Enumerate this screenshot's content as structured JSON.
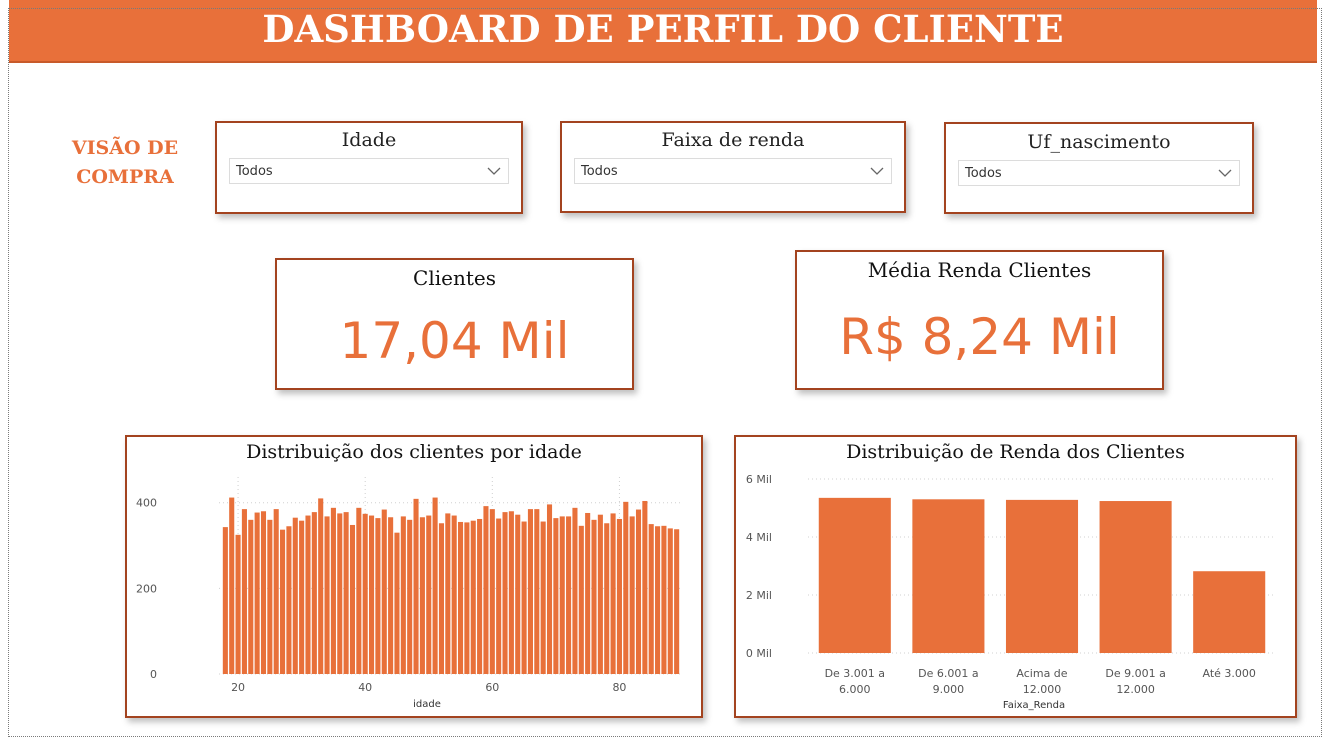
{
  "header": {
    "title": "DASHBOARD DE PERFIL DO CLIENTE"
  },
  "side_label": "VISÃO DE COMPRA",
  "slicers": [
    {
      "title": "Idade",
      "value": "Todos"
    },
    {
      "title": "Faixa de renda",
      "value": "Todos"
    },
    {
      "title": "Uf_nascimento",
      "value": "Todos"
    }
  ],
  "kpis": {
    "clientes": {
      "title": "Clientes",
      "value": "17,04 Mil"
    },
    "media_renda": {
      "title": "Média Renda Clientes",
      "value": "R$ 8,24 Mil"
    }
  },
  "colors": {
    "accent": "#e8703a",
    "border": "#a3431f",
    "bar": "#e8703a"
  },
  "chart_data": [
    {
      "type": "bar",
      "title": "Distribuição dos clientes por idade",
      "xlabel": "idade",
      "ylabel": "",
      "xlim": [
        17,
        90
      ],
      "ylim": [
        0,
        460
      ],
      "yticks": [
        0,
        200,
        400
      ],
      "ytick_labels": [
        "0",
        "200",
        "400"
      ],
      "xticks": [
        20,
        40,
        60,
        80
      ],
      "xtick_labels": [
        "20",
        "40",
        "60",
        "80"
      ],
      "grid": true,
      "x": [
        18,
        19,
        20,
        21,
        22,
        23,
        24,
        25,
        26,
        27,
        28,
        29,
        30,
        31,
        32,
        33,
        34,
        35,
        36,
        37,
        38,
        39,
        40,
        41,
        42,
        43,
        44,
        45,
        46,
        47,
        48,
        49,
        50,
        51,
        52,
        53,
        54,
        55,
        56,
        57,
        58,
        59,
        60,
        61,
        62,
        63,
        64,
        65,
        66,
        67,
        68,
        69,
        70,
        71,
        72,
        73,
        74,
        75,
        76,
        77,
        78,
        79,
        80,
        81,
        82,
        83,
        84,
        85,
        86,
        87,
        88,
        89
      ],
      "values": [
        343,
        412,
        325,
        385,
        360,
        377,
        380,
        360,
        385,
        337,
        345,
        365,
        358,
        370,
        378,
        410,
        368,
        388,
        375,
        378,
        348,
        388,
        374,
        370,
        364,
        384,
        366,
        330,
        368,
        360,
        409,
        366,
        370,
        412,
        352,
        375,
        370,
        355,
        354,
        358,
        362,
        392,
        385,
        363,
        378,
        380,
        372,
        356,
        385,
        385,
        356,
        396,
        364,
        368,
        368,
        388,
        346,
        376,
        360,
        372,
        352,
        375,
        362,
        402,
        368,
        384,
        404,
        350,
        345,
        346,
        340,
        338
      ]
    },
    {
      "type": "bar",
      "title": "Distribuição de Renda dos Clientes",
      "xlabel": "Faixa_Renda",
      "ylabel": "",
      "ylim": [
        0,
        6000
      ],
      "yticks": [
        0,
        2000,
        4000,
        6000
      ],
      "ytick_labels": [
        "0 Mil",
        "2 Mil",
        "4 Mil",
        "6 Mil"
      ],
      "grid": true,
      "categories": [
        "De 3.001 a 6.000",
        "De 6.001 a 9.000",
        "Acima de 12.000",
        "De 9.001 a 12.000",
        "Até 3.000"
      ],
      "category_lines": [
        [
          "De 3.001 a",
          "6.000"
        ],
        [
          "De 6.001 a",
          "9.000"
        ],
        [
          "Acima de",
          "12.000"
        ],
        [
          "De 9.001 a",
          "12.000"
        ],
        [
          "Até 3.000"
        ]
      ],
      "values": [
        5350,
        5300,
        5280,
        5240,
        2820
      ]
    }
  ]
}
